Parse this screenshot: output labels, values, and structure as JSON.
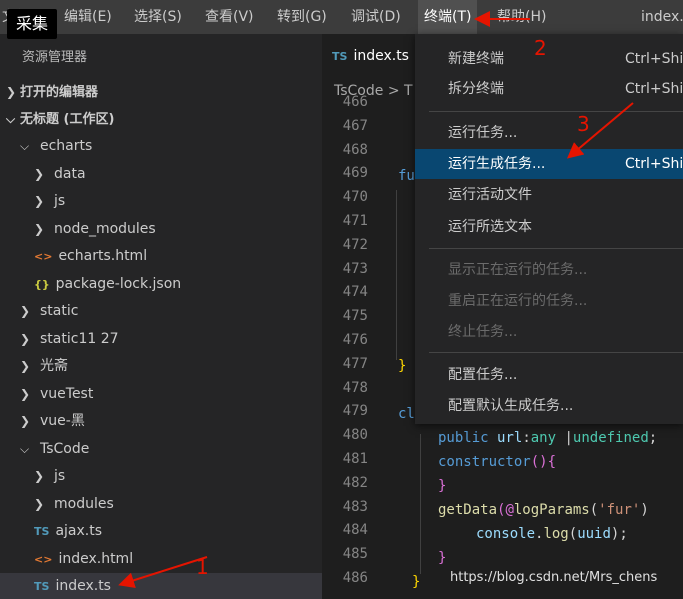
{
  "overlay_badge": "采集",
  "menubar": {
    "items": [
      "文件",
      "编辑(E)",
      "选择(S)",
      "查看(V)",
      "转到(G)",
      "调试(D)",
      "终端(T)",
      "帮助(H)"
    ],
    "window_title": "index.ts"
  },
  "sidebar": {
    "title": "资源管理器",
    "open_editors": "打开的编辑器",
    "workspace": "无标题 (工作区)",
    "tree": [
      {
        "label": "echarts",
        "kind": "folder",
        "expanded": true
      },
      {
        "label": "data",
        "kind": "folder",
        "expanded": false
      },
      {
        "label": "js",
        "kind": "folder",
        "expanded": false
      },
      {
        "label": "node_modules",
        "kind": "folder",
        "expanded": false
      },
      {
        "label": "echarts.html",
        "kind": "html"
      },
      {
        "label": "package-lock.json",
        "kind": "json"
      },
      {
        "label": "static",
        "kind": "folder",
        "expanded": false
      },
      {
        "label": "static11 27",
        "kind": "folder",
        "expanded": false
      },
      {
        "label": "光斋",
        "kind": "folder",
        "expanded": false
      },
      {
        "label": "vueTest",
        "kind": "folder",
        "expanded": false
      },
      {
        "label": "vue-黑",
        "kind": "folder",
        "expanded": false
      },
      {
        "label": "TsCode",
        "kind": "folder",
        "expanded": true
      },
      {
        "label": "js",
        "kind": "folder",
        "expanded": false
      },
      {
        "label": "modules",
        "kind": "folder",
        "expanded": false
      },
      {
        "label": "ajax.ts",
        "kind": "ts"
      },
      {
        "label": "index.html",
        "kind": "html"
      },
      {
        "label": "index.ts",
        "kind": "ts",
        "selected": true
      }
    ],
    "icons": {
      "ts": "TS",
      "html": "<>",
      "json": "{}"
    }
  },
  "editor": {
    "tab": {
      "icon": "TS",
      "label": "index.ts"
    },
    "breadcrumb": "TsCode > T",
    "line_numbers": [
      "466",
      "467",
      "468",
      "469",
      "470",
      "471",
      "472",
      "473",
      "474",
      "475",
      "476",
      "477",
      "478",
      "479",
      "480",
      "481",
      "482",
      "483",
      "484",
      "485",
      "486"
    ],
    "code": {
      "l469": "fu",
      "l477": "}",
      "l479": "cl",
      "l480_a": "public ",
      "l480_b": "url",
      "l480_c": ":",
      "l480_d": "any",
      "l480_e": " |",
      "l480_f": "undefined",
      "l480_g": ";",
      "l481_a": "constructor",
      "l481_b": "(){",
      "l482": "}",
      "l483_a": "getData",
      "l483_b": "(@",
      "l483_c": "logParams",
      "l483_d": "(",
      "l483_e": "'fur'",
      "l483_f": ")",
      "l484_a": "console",
      "l484_b": ".",
      "l484_c": "log",
      "l484_d": "(",
      "l484_e": "uuid",
      "l484_f": ");",
      "l485": "}",
      "l486": "}"
    }
  },
  "terminal_menu": {
    "items": [
      {
        "label": "新建终端",
        "shortcut": "Ctrl+Shi"
      },
      {
        "label": "拆分终端",
        "shortcut": "Ctrl+Shi"
      },
      {
        "label": "运行任务...",
        "shortcut": ""
      },
      {
        "label": "运行生成任务...",
        "shortcut": "Ctrl+Shi",
        "highlight": true
      },
      {
        "label": "运行活动文件",
        "shortcut": ""
      },
      {
        "label": "运行所选文本",
        "shortcut": ""
      },
      {
        "label": "显示正在运行的任务...",
        "shortcut": "",
        "disabled": true
      },
      {
        "label": "重启正在运行的任务...",
        "shortcut": "",
        "disabled": true
      },
      {
        "label": "终止任务...",
        "shortcut": "",
        "disabled": true
      },
      {
        "label": "配置任务...",
        "shortcut": ""
      },
      {
        "label": "配置默认生成任务...",
        "shortcut": ""
      }
    ]
  },
  "annotations": {
    "n1": "1",
    "n2": "2",
    "n3": "3",
    "color": "#e51400"
  },
  "watermark": "https://blog.csdn.net/Mrs_chens"
}
